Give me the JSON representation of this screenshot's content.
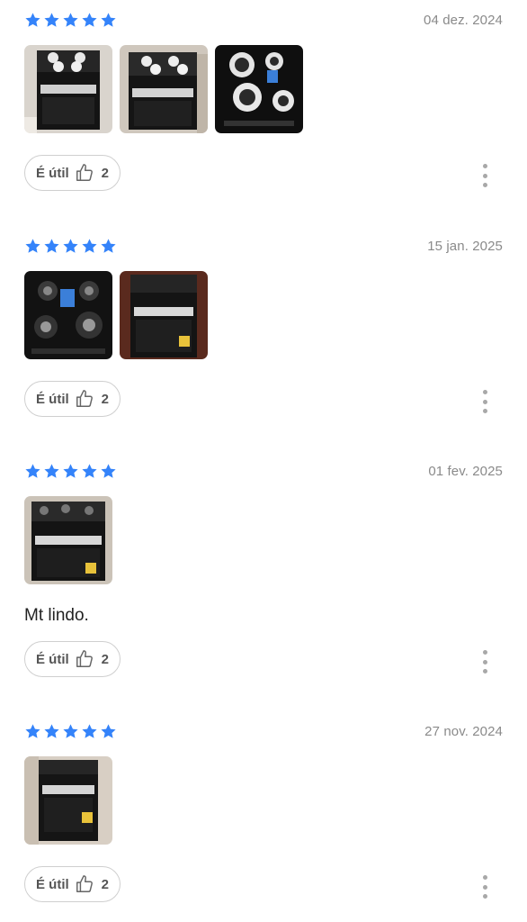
{
  "accent_star_color": "#3483fa",
  "reviews": [
    {
      "rating": 5,
      "date": "04 dez. 2024",
      "photos": [
        "stove-photo",
        "stove-photo",
        "cooktop-photo"
      ],
      "text": "",
      "helpful_label": "É útil",
      "helpful_count": "2"
    },
    {
      "rating": 5,
      "date": "15 jan. 2025",
      "photos": [
        "cooktop-photo",
        "stove-photo"
      ],
      "text": "",
      "helpful_label": "É útil",
      "helpful_count": "2"
    },
    {
      "rating": 5,
      "date": "01 fev. 2025",
      "photos": [
        "stove-photo"
      ],
      "text": "Mt lindo.",
      "helpful_label": "É útil",
      "helpful_count": "2"
    },
    {
      "rating": 5,
      "date": "27 nov. 2024",
      "photos": [
        "stove-photo"
      ],
      "text": "",
      "helpful_label": "É útil",
      "helpful_count": "2"
    }
  ]
}
